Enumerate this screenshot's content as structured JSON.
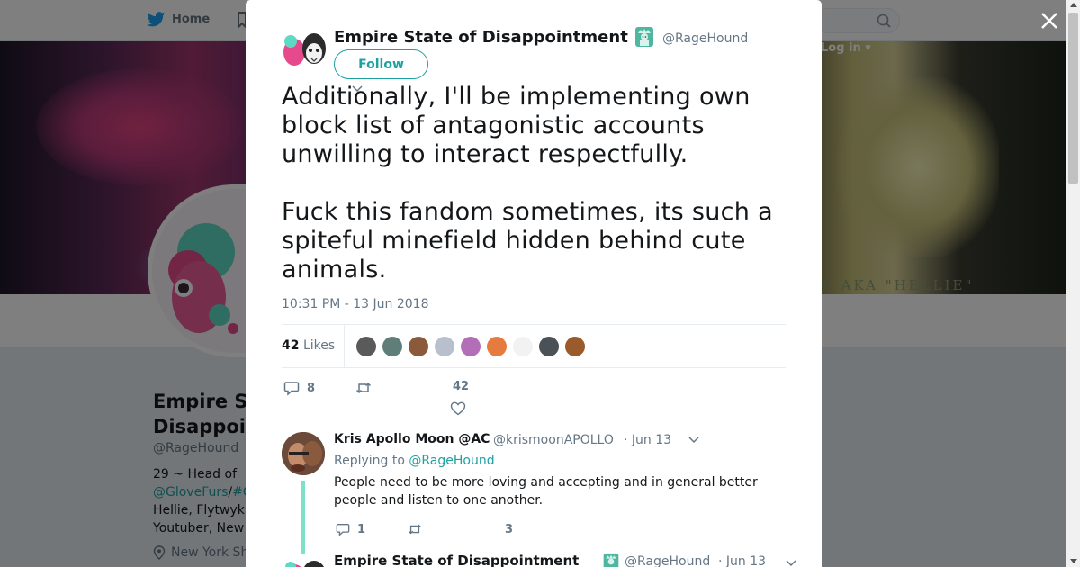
{
  "topbar": {
    "home_label": "Home",
    "login_label": "Log in ▾"
  },
  "banner": {
    "caption": "E AKA \"HELLIE\""
  },
  "profile": {
    "name": "Empire State of Disappointment",
    "name_visible": "Empire S… Disappoi…",
    "name_line1": "Empire S",
    "name_line2": "Disappoi",
    "handle": "@RageHound",
    "bio_line1": "29 ~ Head of",
    "bio_link1": "@GloveFurs",
    "bio_sep": "/",
    "bio_link2": "#G",
    "bio_line3": "Hellie, Flytwyk",
    "bio_line4": "Youtuber, New",
    "location": "New York Sh"
  },
  "tweet": {
    "author_name": "Empire State of Disappointment",
    "author_handle": "@RageHound",
    "follow_label": "Follow",
    "paragraph1": "Additionally, I'll be implementing own\nblock list of antagonistic accounts\nunwilling to interact respectfully.",
    "paragraph2": "Fuck this fandom sometimes, its such a\nspiteful minefield hidden behind cute\nanimals.",
    "timestamp": "10:31 PM - 13 Jun 2018",
    "likes_count": "42",
    "likes_label": "Likes",
    "reply_count": "8",
    "like_count": "42",
    "likers": [
      {
        "name": "liker-1",
        "color": "#5a5a5a"
      },
      {
        "name": "liker-2",
        "color": "#5f7e7a"
      },
      {
        "name": "liker-3",
        "color": "#8a5a3a"
      },
      {
        "name": "liker-4",
        "color": "#b7c0cc"
      },
      {
        "name": "liker-5",
        "color": "#b26fb8"
      },
      {
        "name": "liker-6",
        "color": "#e57b3e"
      },
      {
        "name": "liker-7",
        "color": "#f2f2f2"
      },
      {
        "name": "liker-8",
        "color": "#4a5157"
      },
      {
        "name": "liker-9",
        "color": "#9a5a2a"
      }
    ]
  },
  "reply": {
    "name": "Kris Apollo Moon @AC",
    "handle": "@krismoonAPOLLO",
    "date": "· Jun 13",
    "replying_prefix": "Replying to",
    "replying_handle": "@RageHound",
    "text": "People need to be more loving and accepting and in general better people and listen to one another.",
    "reply_count": "1",
    "like_count": "3"
  },
  "next_tweet": {
    "name": "Empire State of Disappointment",
    "handle": "@RageHound",
    "date": "· Jun 13"
  },
  "colors": {
    "accent": "#1da1a1",
    "twitter_blue": "#1da1f2",
    "text_secondary": "#657786",
    "thread_line": "#7ee0c8"
  }
}
